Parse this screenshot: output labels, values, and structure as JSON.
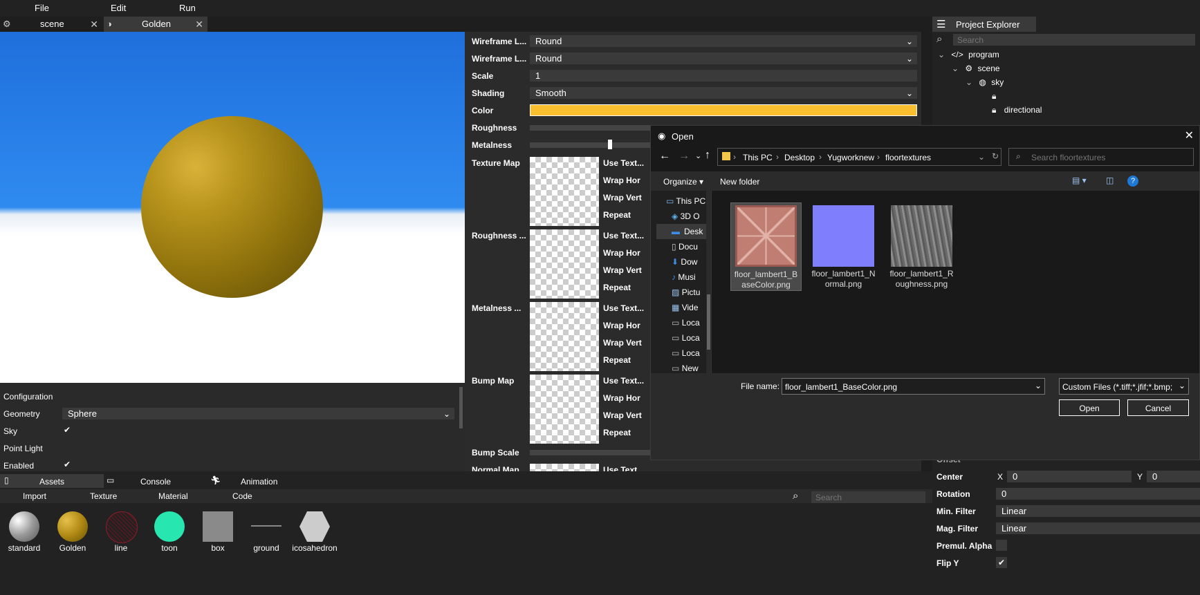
{
  "menu": {
    "file": "File",
    "edit": "Edit",
    "run": "Run"
  },
  "tabs": [
    {
      "label": "scene"
    },
    {
      "label": "Golden"
    }
  ],
  "config": {
    "title": "Configuration",
    "geometry_label": "Geometry",
    "geometry_value": "Sphere",
    "sky_label": "Sky",
    "point_light_label": "Point Light",
    "enabled_label": "Enabled"
  },
  "material": {
    "wireframe1_label": "Wireframe L...",
    "wireframe1_value": "Round",
    "wireframe2_label": "Wireframe L...",
    "wireframe2_value": "Round",
    "scale_label": "Scale",
    "scale_value": "1",
    "shading_label": "Shading",
    "shading_value": "Smooth",
    "color_label": "Color",
    "color_hex": "#f9bf2e",
    "roughness_label": "Roughness",
    "metalness_label": "Metalness",
    "metalness_level": 0.45,
    "texture_map_label": "Texture Map",
    "roughness_map_label": "Roughness ...",
    "metalness_map_label": "Metalness ...",
    "bump_map_label": "Bump Map",
    "bump_scale_label": "Bump Scale",
    "normal_map_label": "Normal Map",
    "use_texture": "Use Text...",
    "wrap_hor": "Wrap Hor",
    "wrap_vert": "Wrap Vert",
    "repeat": "Repeat"
  },
  "explorer": {
    "title": "Project Explorer",
    "search_placeholder": "Search",
    "tree": {
      "program": "program",
      "scene": "scene",
      "sky": "sky",
      "directional": "directional"
    },
    "props": {
      "offset_label": "Offset",
      "center_label": "Center",
      "center_x_label": "X",
      "center_x": "0",
      "center_y_label": "Y",
      "center_y": "0",
      "rotation_label": "Rotation",
      "rotation_value": "0",
      "min_filter_label": "Min. Filter",
      "min_filter_value": "Linear",
      "mag_filter_label": "Mag. Filter",
      "mag_filter_value": "Linear",
      "premul_label": "Premul. Alpha",
      "flipy_label": "Flip Y"
    }
  },
  "bottom": {
    "tabs": {
      "assets": "Assets",
      "console": "Console",
      "animation": "Animation"
    },
    "toolbar": {
      "import": "Import",
      "texture": "Texture",
      "material": "Material",
      "code": "Code"
    },
    "search_placeholder": "Search",
    "assets": [
      {
        "label": "standard"
      },
      {
        "label": "Golden"
      },
      {
        "label": "line"
      },
      {
        "label": "toon"
      },
      {
        "label": "box"
      },
      {
        "label": "ground"
      },
      {
        "label": "icosahedron"
      }
    ]
  },
  "dialog": {
    "title": "Open",
    "breadcrumb": [
      "This PC",
      "Desktop",
      "Yugworknew",
      "floortextures"
    ],
    "search_placeholder": "Search floortextures",
    "organize": "Organize",
    "new_folder": "New folder",
    "nav": [
      "This PC",
      "3D O",
      "Desk",
      "Docu",
      "Dow",
      "Musi",
      "Pictu",
      "Vide",
      "Loca",
      "Loca",
      "Loca",
      "New"
    ],
    "files": [
      {
        "name1": "floor_lambert1_B",
        "name2": "aseColor.png"
      },
      {
        "name1": "floor_lambert1_N",
        "name2": "ormal.png"
      },
      {
        "name1": "floor_lambert1_R",
        "name2": "oughness.png"
      }
    ],
    "filename_label": "File name:",
    "filename_value": "floor_lambert1_BaseColor.png",
    "filetype_value": "Custom Files (*.tiff;*.jfif;*.bmp;",
    "open_button": "Open",
    "cancel_button": "Cancel"
  }
}
